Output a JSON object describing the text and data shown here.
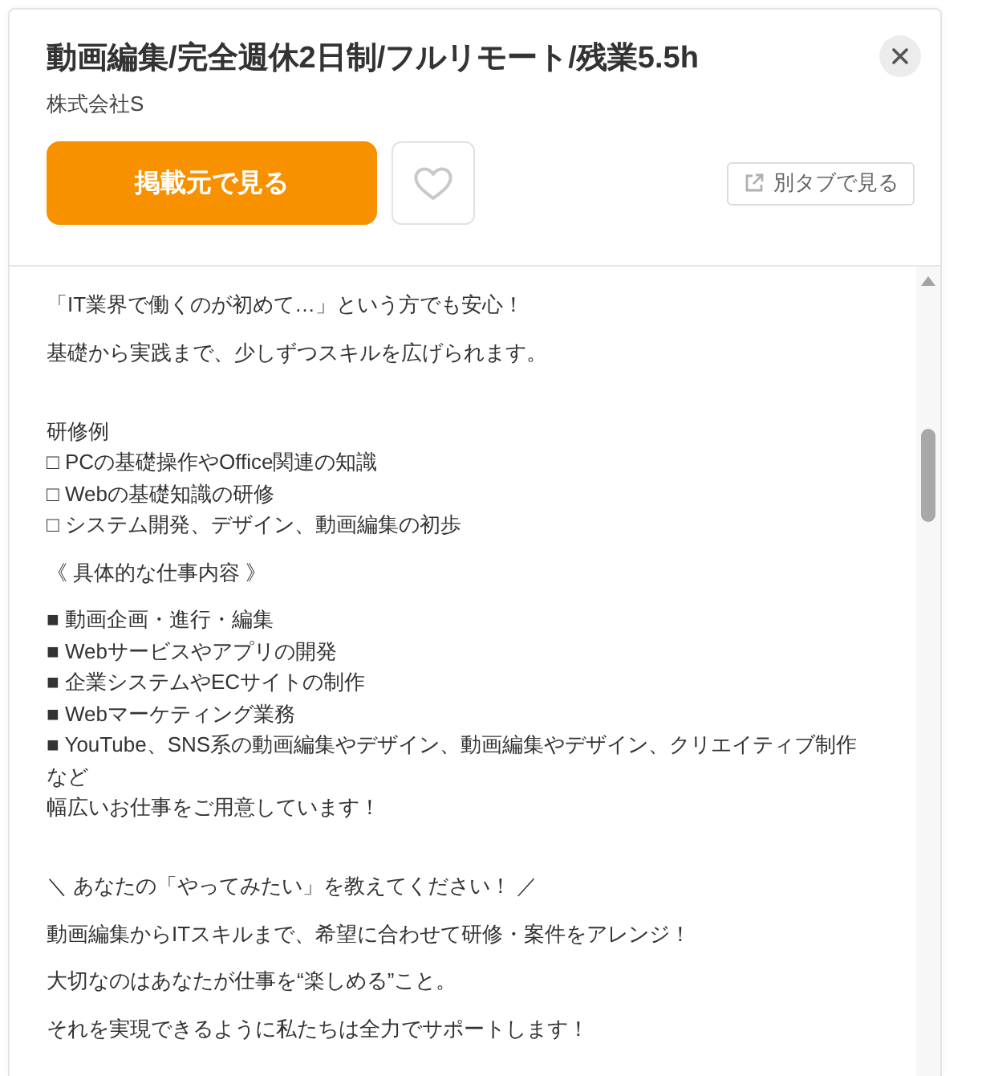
{
  "job": {
    "title": "動画編集/完全週休2日制/フルリモート/残業5.5h",
    "company": "株式会社S"
  },
  "actions": {
    "primary": "掲載元で見る",
    "favorite": {
      "selected": false
    },
    "open_tab": "別タブで見る"
  },
  "description": {
    "blocks": [
      {
        "kind": "text",
        "lines": [
          "「IT業界で働くのが初めて…」という方でも安心！"
        ]
      },
      {
        "kind": "text",
        "lines": [
          "基礎から実践まで、少しずつスキルを広げられます。"
        ]
      },
      {
        "kind": "blank"
      },
      {
        "kind": "text",
        "lines": [
          "研修例",
          "□ PCの基礎操作やOffice関連の知識",
          "□ Webの基礎知識の研修",
          "□ システム開発、デザイン、動画編集の初歩"
        ]
      },
      {
        "kind": "text",
        "lines": [
          "《 具体的な仕事内容 》"
        ]
      },
      {
        "kind": "text",
        "lines": [
          "■ 動画企画・進行・編集",
          "■ Webサービスやアプリの開発",
          "■ 企業システムやECサイトの制作",
          "■ Webマーケティング業務",
          "■ YouTube、SNS系の動画編集やデザイン、動画編集やデザイン、クリエイティブ制作など",
          "幅広いお仕事をご用意しています！"
        ]
      },
      {
        "kind": "blank"
      },
      {
        "kind": "text",
        "lines": [
          "＼ あなたの「やってみたい」を教えてください！ ／"
        ]
      },
      {
        "kind": "text",
        "lines": [
          "動画編集からITスキルまで、希望に合わせて研修・案件をアレンジ！"
        ]
      },
      {
        "kind": "text",
        "lines": [
          "大切なのはあなたが仕事を“楽しめる”こと。"
        ]
      },
      {
        "kind": "text",
        "lines": [
          "それを実現できるように私たちは全力でサポートします！"
        ]
      }
    ]
  }
}
